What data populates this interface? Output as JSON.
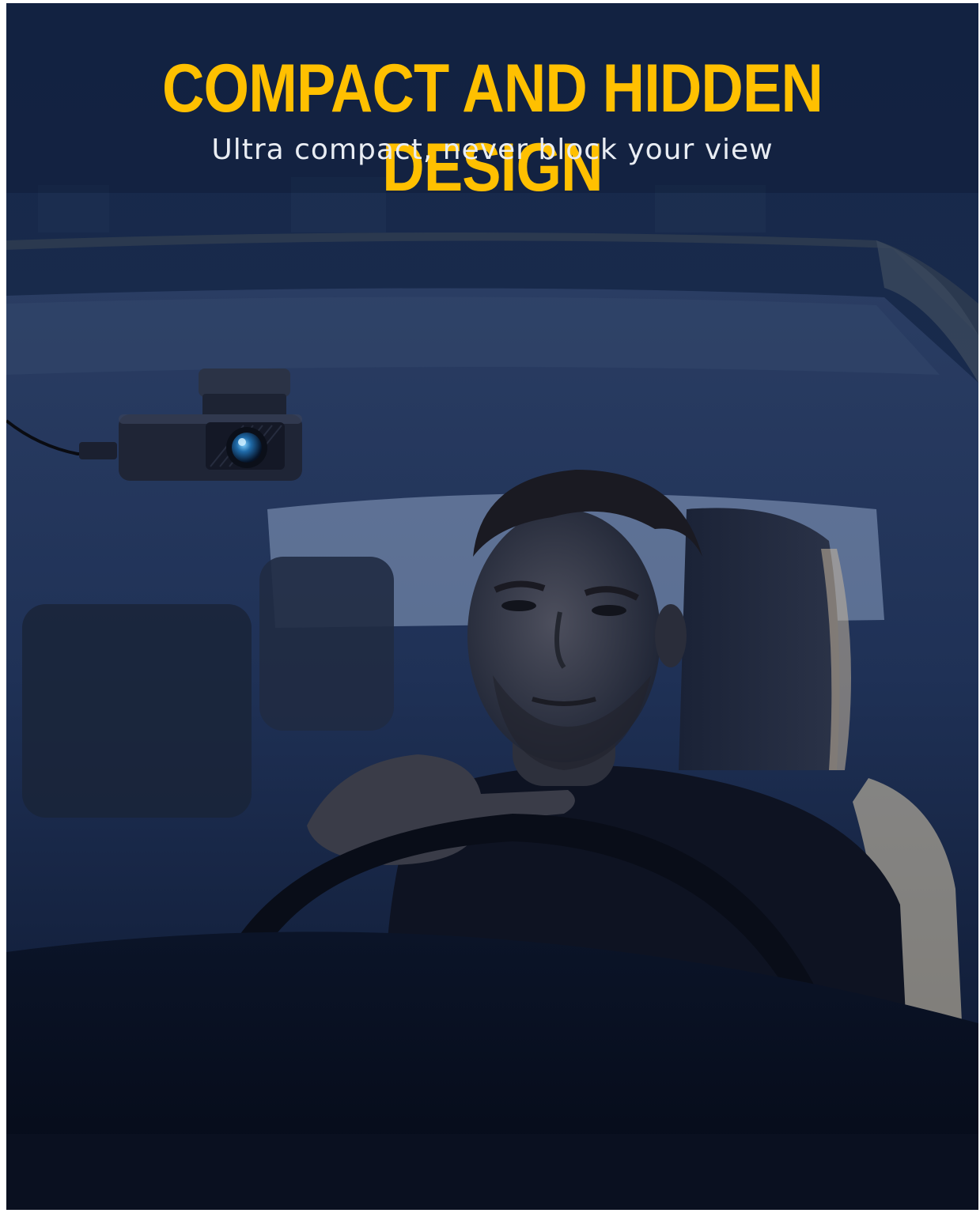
{
  "banner": {
    "headline": "COMPACT AND HIDDEN DESIGN",
    "subheadline": "Ultra compact, never block your view",
    "accent_color": "#ffc000",
    "subheadline_color": "#e9edf3"
  },
  "photo": {
    "subjects": [
      "dash-cam",
      "driver",
      "steering-wheel",
      "car-interior"
    ]
  }
}
